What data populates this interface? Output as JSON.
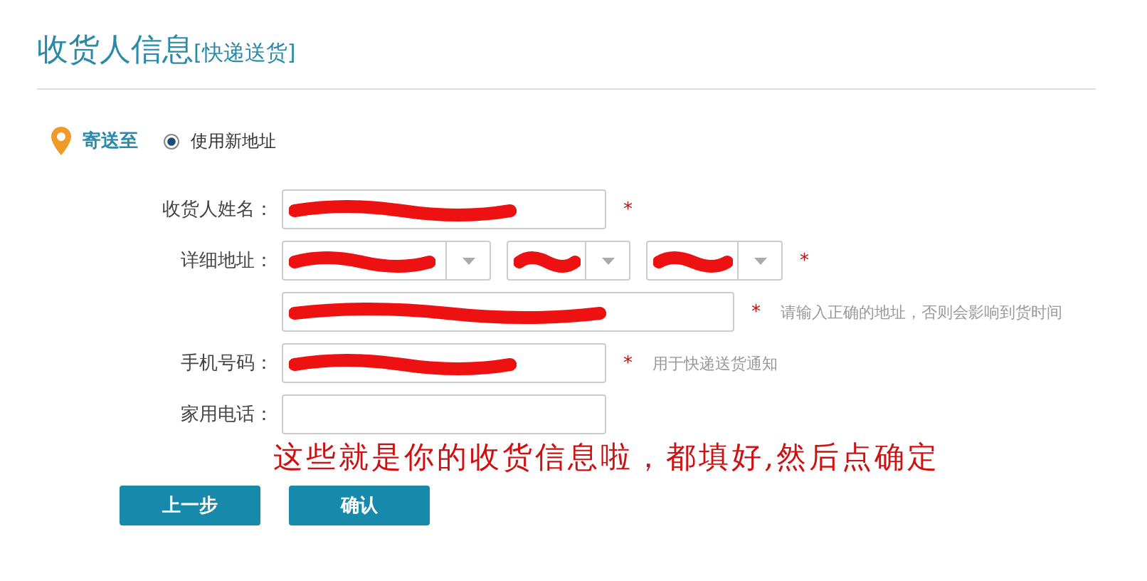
{
  "header": {
    "title": "收货人信息",
    "subtitle": "[快递送货]"
  },
  "ship_to": {
    "label": "寄送至",
    "options": [
      {
        "label": "使用新地址",
        "selected": true
      }
    ]
  },
  "rows": [
    {
      "kind": "input",
      "label": "收货人姓名：",
      "fields": [
        {
          "redacted": true
        }
      ],
      "required_mark": "*"
    },
    {
      "kind": "select",
      "label": "详细地址：",
      "fields": [
        {
          "redacted": true
        },
        {
          "redacted": true
        },
        {
          "redacted": true
        }
      ],
      "required_mark": "*"
    },
    {
      "kind": "input",
      "label": "",
      "fields": [
        {
          "redacted": true
        }
      ],
      "required_mark": "*",
      "hint": "请输入正确的地址，否则会影响到货时间"
    },
    {
      "kind": "input",
      "label": "手机号码：",
      "fields": [
        {
          "redacted": true
        }
      ],
      "required_mark": "*",
      "hint": "用于快递送货通知"
    },
    {
      "kind": "input",
      "label": "家用电话：",
      "fields": [
        {
          "redacted": false
        }
      ]
    }
  ],
  "annotation": "这些就是你的收货信息啦，都填好,然后点确定",
  "buttons": [
    "上一步",
    "确认"
  ]
}
